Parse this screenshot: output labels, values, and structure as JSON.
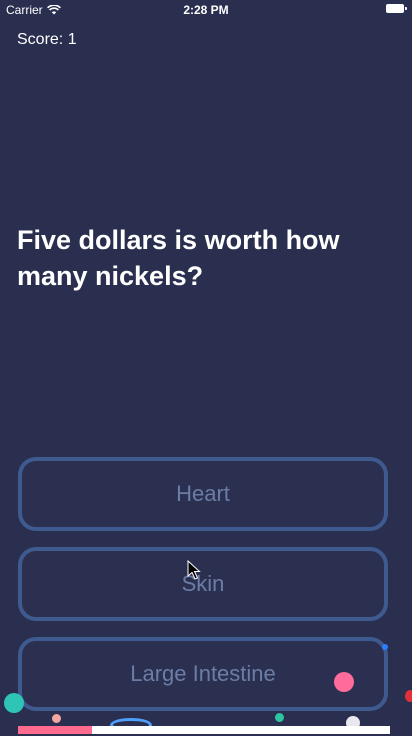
{
  "status_bar": {
    "carrier": "Carrier",
    "time": "2:28 PM",
    "icons": [
      "wifi-icon",
      "battery-icon"
    ]
  },
  "score_text": "Score: 1",
  "question": "Five dollars is worth how many nickels?",
  "answers": [
    "Heart",
    "Skin",
    "Large Intestine"
  ],
  "progress_fraction": 0.2,
  "colors": {
    "background": "#2a2f4f",
    "answer_border": "#3f5a8f",
    "answer_text": "#6b7da6",
    "progress_fill": "#ff6b8f"
  }
}
